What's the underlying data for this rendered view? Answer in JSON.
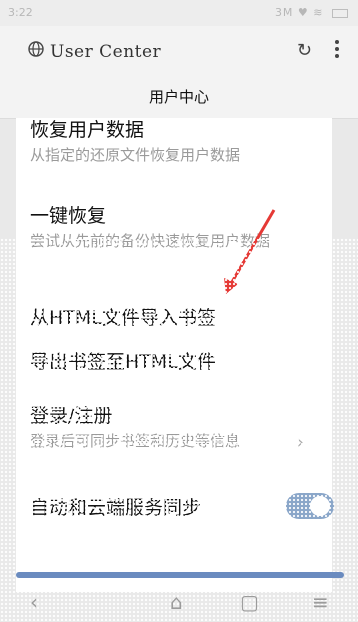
{
  "status": {
    "time": "3:22",
    "right": "3M ♥ ≋"
  },
  "header": {
    "url": "User Center",
    "title": "用户中心"
  },
  "items": [
    {
      "title": "恢复用户数据",
      "desc": "从指定的还原文件恢复用户数据"
    },
    {
      "title": "一键恢复",
      "desc": "尝试从先前的备份快速恢复用户数据"
    },
    {
      "title": "从HTML文件导入书签"
    },
    {
      "title": "导出书签至HTML文件"
    },
    {
      "title": "登录/注册",
      "desc": "登录后可同步书签和历史等信息"
    },
    {
      "title": "自动和云端服务同步"
    }
  ],
  "toggle": {
    "on": true
  },
  "colors": {
    "accent": "#6a8bbf",
    "toggle": "#8aa6c9"
  },
  "nav": {
    "back": "‹",
    "home": "⌂",
    "tabs": "▢",
    "menu": "≡"
  }
}
